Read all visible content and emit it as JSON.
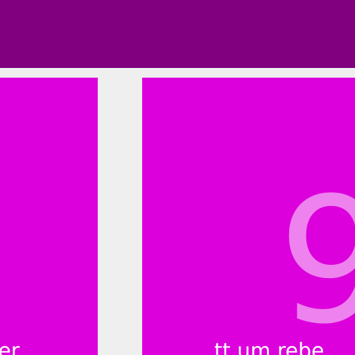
{
  "colors": {
    "header": "#800080",
    "tile": "#dc00dc",
    "background": "#efefef",
    "number": "#ee82ee",
    "caption": "#ffffff"
  },
  "tiles": [
    {
      "caption": "oder"
    },
    {
      "number": "9",
      "caption": "tt um rebe"
    }
  ]
}
